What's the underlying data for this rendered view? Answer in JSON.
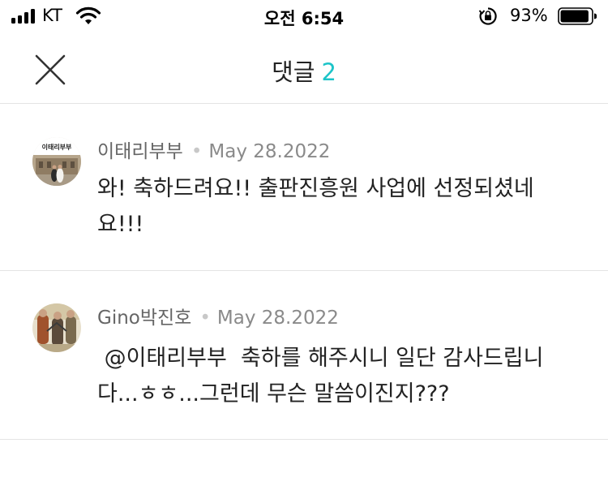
{
  "status_bar": {
    "carrier": "KT",
    "time": "오전 6:54",
    "battery_percent": "93%",
    "battery_level": 0.93
  },
  "header": {
    "title": "댓글",
    "count": "2",
    "accent_color": "#1cc4c8"
  },
  "comments": [
    {
      "author": "이태리부부",
      "date": "May 28.2022",
      "avatar_text": "이태리부부",
      "text": "와! 축하드려요!! 출판진흥원 사업에 선정되셨네요!!!"
    },
    {
      "author": "Gino박진호",
      "date": "May 28.2022",
      "mention": "@이태리부부",
      "text": "축하를 해주시니 일단 감사드립니다...ㅎㅎ...그런데 무슨 말씀이진지???"
    }
  ],
  "icons": {
    "close": "close-icon",
    "signal": "signal-icon",
    "wifi": "wifi-icon",
    "rotation_lock": "rotation-lock-icon",
    "battery": "battery-icon"
  }
}
